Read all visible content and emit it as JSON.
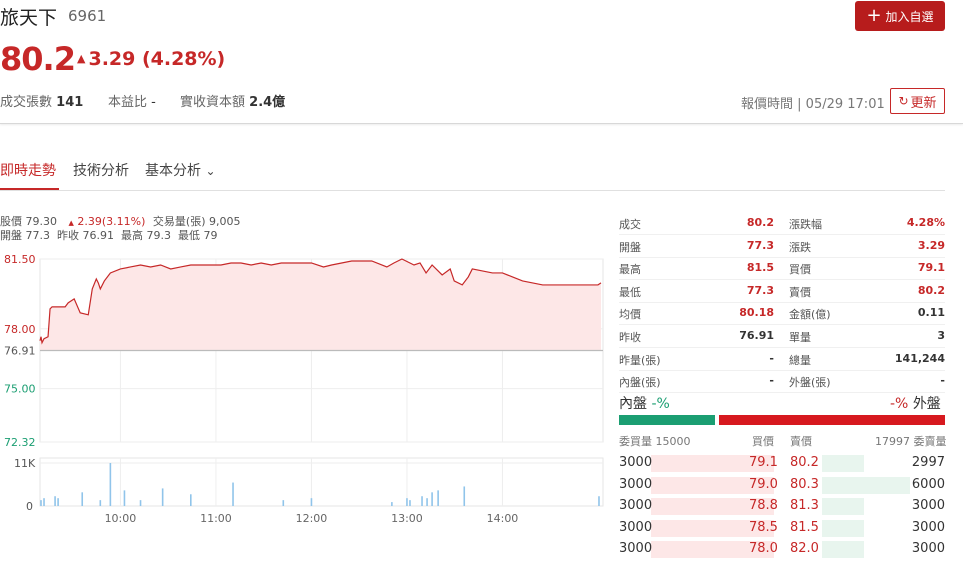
{
  "stock": {
    "name": "旅天下",
    "code": "6961",
    "price": "80.2",
    "change_text": "3.29 (4.28%)"
  },
  "meta": [
    {
      "label": "成交張數",
      "value": "141"
    },
    {
      "label": "本益比",
      "value": "-"
    },
    {
      "label": "實收資本額",
      "value": "2.4億"
    }
  ],
  "actions": {
    "add_label": "加入自選",
    "refresh_label": "更新"
  },
  "quote_time": {
    "label": "報價時間",
    "value": "05/29 17:01"
  },
  "tabs": [
    {
      "label": "即時走勢"
    },
    {
      "label": "技術分析"
    },
    {
      "label": "基本分析"
    }
  ],
  "chart_info": {
    "line1": {
      "price_label": "股價",
      "price": "79.30",
      "change": "2.39(3.11%)",
      "vol_label": "交易量(張)",
      "vol": "9,005"
    },
    "line2": "開盤 77.3  昨收 76.91  最高 79.3  最低 79"
  },
  "colors": {
    "up": "#c62828",
    "down": "#1b9e72",
    "area": "#fde7e7"
  },
  "chart_data": {
    "type": "area",
    "y_ticks": [
      "81.50",
      "78.00",
      "76.91",
      "75.00",
      "72.32"
    ],
    "x_ticks": [
      "10:00",
      "11:00",
      "12:00",
      "13:00",
      "14:00"
    ],
    "ylim": [
      72.32,
      81.5
    ],
    "ref_line": 76.91,
    "vol_ticks": [
      "11K",
      "0"
    ],
    "price_series": [
      [
        0,
        77.4
      ],
      [
        1,
        77.6
      ],
      [
        2,
        77.3
      ],
      [
        4,
        77.5
      ],
      [
        8,
        77.6
      ],
      [
        10,
        79.0
      ],
      [
        12,
        79.1
      ],
      [
        14,
        79.1
      ],
      [
        20,
        79.1
      ],
      [
        25,
        79.1
      ],
      [
        28,
        79.3
      ],
      [
        34,
        79.5
      ],
      [
        40,
        78.8
      ],
      [
        48,
        78.7
      ],
      [
        52,
        80.0
      ],
      [
        56,
        80.5
      ],
      [
        58,
        80.3
      ],
      [
        60,
        80.0
      ],
      [
        64,
        80.4
      ],
      [
        70,
        80.8
      ],
      [
        80,
        81.0
      ],
      [
        90,
        81.1
      ],
      [
        100,
        81.2
      ],
      [
        110,
        81.1
      ],
      [
        120,
        81.2
      ],
      [
        130,
        81.0
      ],
      [
        140,
        81.1
      ],
      [
        150,
        81.2
      ],
      [
        160,
        81.2
      ],
      [
        170,
        81.2
      ],
      [
        180,
        81.2
      ],
      [
        190,
        81.3
      ],
      [
        200,
        81.3
      ],
      [
        210,
        81.2
      ],
      [
        220,
        81.3
      ],
      [
        230,
        81.2
      ],
      [
        240,
        81.3
      ],
      [
        250,
        81.3
      ],
      [
        260,
        81.3
      ],
      [
        270,
        81.3
      ],
      [
        282,
        81.1
      ],
      [
        290,
        81.2
      ],
      [
        300,
        81.3
      ],
      [
        310,
        81.4
      ],
      [
        320,
        81.4
      ],
      [
        330,
        81.4
      ],
      [
        340,
        81.2
      ],
      [
        345,
        81.1
      ],
      [
        352,
        81.3
      ],
      [
        360,
        81.5
      ],
      [
        368,
        81.3
      ],
      [
        372,
        81.2
      ],
      [
        378,
        81.3
      ],
      [
        384,
        80.8
      ],
      [
        390,
        81.2
      ],
      [
        396,
        80.9
      ],
      [
        400,
        80.7
      ],
      [
        408,
        81.0
      ],
      [
        412,
        80.4
      ],
      [
        420,
        80.2
      ],
      [
        426,
        80.6
      ],
      [
        430,
        81.0
      ],
      [
        440,
        80.9
      ],
      [
        450,
        80.8
      ],
      [
        460,
        80.8
      ],
      [
        470,
        80.6
      ],
      [
        480,
        80.4
      ],
      [
        490,
        80.3
      ],
      [
        500,
        80.2
      ],
      [
        510,
        80.2
      ],
      [
        520,
        80.2
      ],
      [
        530,
        80.2
      ],
      [
        540,
        80.2
      ],
      [
        555,
        80.2
      ],
      [
        558,
        80.3
      ]
    ],
    "volume_bars": [
      [
        1,
        1.5
      ],
      [
        4,
        2.0
      ],
      [
        15,
        2.5
      ],
      [
        18,
        2.0
      ],
      [
        42,
        3.5
      ],
      [
        60,
        1.5
      ],
      [
        70,
        11.0
      ],
      [
        84,
        4.0
      ],
      [
        100,
        1.5
      ],
      [
        122,
        4.5
      ],
      [
        150,
        3.0
      ],
      [
        192,
        6.0
      ],
      [
        242,
        1.5
      ],
      [
        270,
        2.0
      ],
      [
        350,
        1.0
      ],
      [
        365,
        2.0
      ],
      [
        368,
        1.5
      ],
      [
        380,
        2.5
      ],
      [
        385,
        2.0
      ],
      [
        390,
        3.5
      ],
      [
        396,
        4.0
      ],
      [
        422,
        5.0
      ],
      [
        556,
        2.5
      ]
    ],
    "vol_max": 11
  },
  "summary": [
    {
      "left_label": "成交",
      "left_value": "80.2",
      "left_red": true,
      "right_label": "漲跌幅",
      "right_value": "4.28%",
      "right_red": true
    },
    {
      "left_label": "開盤",
      "left_value": "77.3",
      "left_red": true,
      "right_label": "漲跌",
      "right_value": "3.29",
      "right_red": true
    },
    {
      "left_label": "最高",
      "left_value": "81.5",
      "left_red": true,
      "right_label": "買價",
      "right_value": "79.1",
      "right_red": true
    },
    {
      "left_label": "最低",
      "left_value": "77.3",
      "left_red": true,
      "right_label": "賣價",
      "right_value": "80.2",
      "right_red": true
    },
    {
      "left_label": "均價",
      "left_value": "80.18",
      "left_red": true,
      "right_label": "金額(億)",
      "right_value": "0.11",
      "right_red": false
    },
    {
      "left_label": "昨收",
      "left_value": "76.91",
      "left_red": false,
      "right_label": "單量",
      "right_value": "3",
      "right_red": false
    },
    {
      "left_label": "昨量(張)",
      "left_value": "-",
      "left_red": false,
      "right_label": "總量",
      "right_value": "141,244",
      "right_red": false
    },
    {
      "left_label": "內盤(張)",
      "left_value": "-",
      "left_red": false,
      "right_label": "外盤(張)",
      "right_value": "-",
      "right_red": false
    }
  ],
  "ratio": {
    "inner_label": "內盤",
    "inner_value": "-%",
    "outer_value": "-%",
    "outer_label": "外盤"
  },
  "orderbook": {
    "headers": {
      "bid_vol": "委買量 15000",
      "bid": "買價",
      "ask": "賣價",
      "ask_vol": "17997 委賣量"
    },
    "rows": [
      {
        "bid_vol": "3000",
        "bid": "79.1",
        "ask": "80.2",
        "ask_vol": "2997"
      },
      {
        "bid_vol": "3000",
        "bid": "79.0",
        "ask": "80.3",
        "ask_vol": "6000"
      },
      {
        "bid_vol": "3000",
        "bid": "78.8",
        "ask": "81.3",
        "ask_vol": "3000"
      },
      {
        "bid_vol": "3000",
        "bid": "78.5",
        "ask": "81.5",
        "ask_vol": "3000"
      },
      {
        "bid_vol": "3000",
        "bid": "78.0",
        "ask": "82.0",
        "ask_vol": "3000"
      }
    ],
    "ask_vol_ratio": [
      0.2,
      0.4,
      0.2,
      0.2,
      0.2
    ]
  }
}
